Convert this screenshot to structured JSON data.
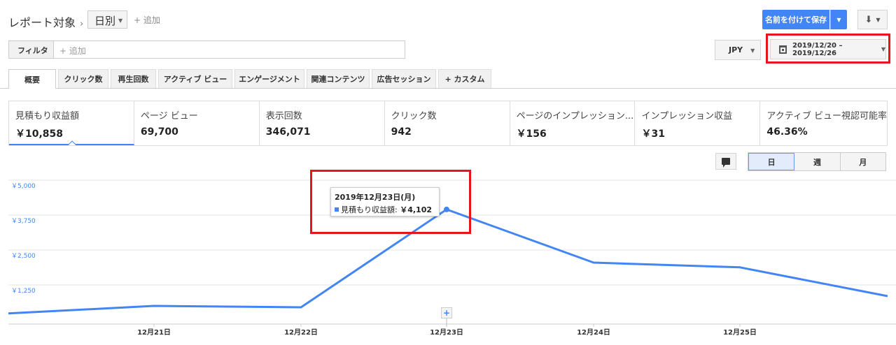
{
  "header": {
    "title": "レポート対象",
    "granularity": "日別",
    "add_label": "+ 追加",
    "save_label": "名前を付けて保存"
  },
  "filter": {
    "label": "フィルタ",
    "placeholder": "+ 追加"
  },
  "currency": "JPY",
  "date_range": "2019/12/20 – 2019/12/26",
  "tabs": [
    {
      "label": "概要",
      "active": true
    },
    {
      "label": "クリック数"
    },
    {
      "label": "再生回数"
    },
    {
      "label": "アクティブ ビュー"
    },
    {
      "label": "エンゲージメント"
    },
    {
      "label": "関連コンテンツ"
    },
    {
      "label": "広告セッション"
    },
    {
      "label": "+ カスタム"
    }
  ],
  "metrics": [
    {
      "name": "見積もり収益額",
      "value": "￥10,858",
      "selected": true
    },
    {
      "name": "ページ ビュー",
      "value": "69,700"
    },
    {
      "name": "表示回数",
      "value": "346,071"
    },
    {
      "name": "クリック数",
      "value": "942"
    },
    {
      "name": "ページのインプレッション...",
      "value": "￥156"
    },
    {
      "name": "インプレッション収益",
      "value": "￥31"
    },
    {
      "name": "アクティブ ビュー視認可能率",
      "value": "46.36%"
    }
  ],
  "period_buttons": [
    {
      "label": "日",
      "active": true
    },
    {
      "label": "週"
    },
    {
      "label": "月"
    }
  ],
  "tooltip": {
    "date": "2019年12月23日(月)",
    "series": "見積もり収益額:",
    "value": "￥4,102"
  },
  "colors": {
    "accent": "#4285f4",
    "highlight": "#e8141b"
  },
  "chart_data": {
    "type": "line",
    "x": [
      "2019-12-20",
      "2019-12-21",
      "2019-12-22",
      "2019-12-23",
      "2019-12-24",
      "2019-12-25",
      "2019-12-26"
    ],
    "x_tick_labels": [
      "12月21日",
      "12月22日",
      "12月23日",
      "12月24日",
      "12月25日"
    ],
    "y_tick_labels": [
      "￥5,000",
      "￥3,750",
      "￥2,500",
      "￥1,250"
    ],
    "y_ticks": [
      5000,
      3750,
      2500,
      1250
    ],
    "ylim": [
      0,
      5000
    ],
    "series": [
      {
        "values": [
          380,
          650,
          600,
          4102,
          2200,
          2030,
          1000
        ]
      }
    ],
    "grid": true
  }
}
